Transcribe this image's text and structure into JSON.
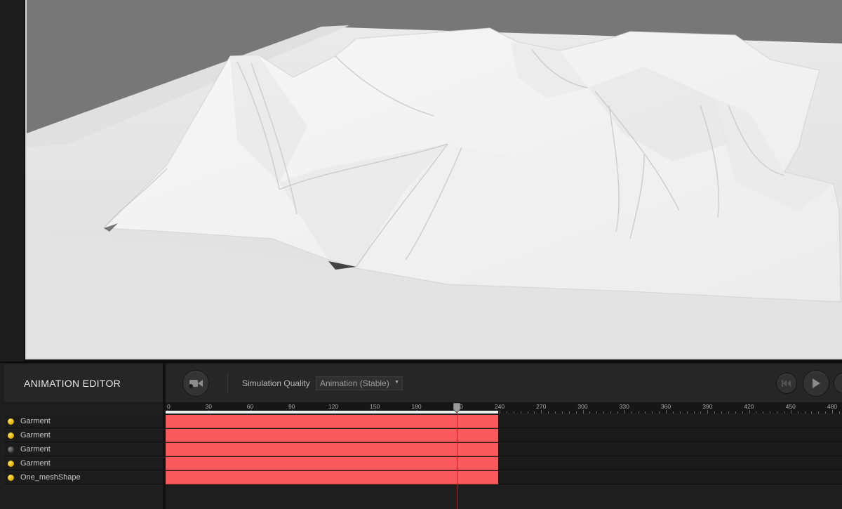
{
  "viewport": {
    "background": "#777777",
    "mesh_color": "#f2f2f2"
  },
  "editor": {
    "title": "ANIMATION EDITOR",
    "record_icon": "camera-record-icon",
    "simulation_quality_label": "Simulation Quality",
    "simulation_quality_value": "Animation (Stable)",
    "transport": {
      "rewind_icon": "rewind-to-start-icon",
      "play_icon": "play-icon"
    }
  },
  "timeline": {
    "ruler_labels": [
      "0",
      "30",
      "60",
      "90",
      "120",
      "150",
      "180",
      "210",
      "240",
      "270",
      "300",
      "330",
      "360",
      "390",
      "420",
      "450",
      "480"
    ],
    "playhead_frame": 210,
    "clip_start_frame": 0,
    "clip_end_frame": 240,
    "clip_color": "#fa5a5c",
    "playhead_color": "#d21818"
  },
  "tracks": [
    {
      "name": "Garment",
      "enabled": true
    },
    {
      "name": "Garment",
      "enabled": true
    },
    {
      "name": "Garment",
      "enabled": false
    },
    {
      "name": "Garment",
      "enabled": true
    },
    {
      "name": "One_meshShape",
      "enabled": true
    }
  ]
}
